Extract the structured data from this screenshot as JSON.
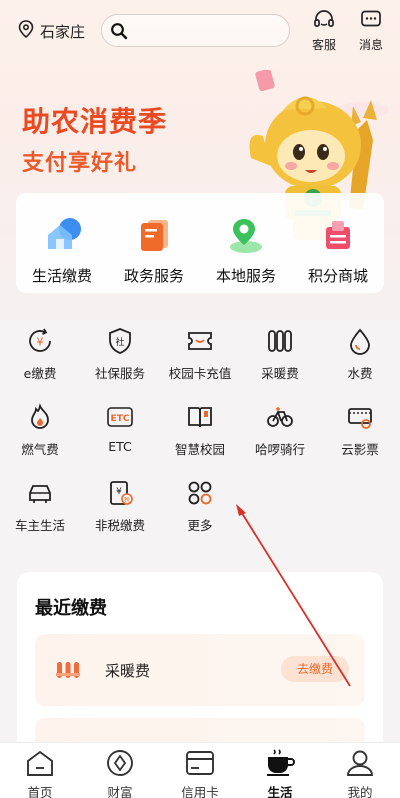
{
  "location": {
    "city": "石家庄"
  },
  "search": {
    "placeholder": ""
  },
  "top_actions": [
    {
      "label": "客服",
      "icon": "headset-icon"
    },
    {
      "label": "消息",
      "icon": "message-icon"
    }
  ],
  "banner": {
    "title": "助农消费季",
    "subtitle": "支付享好礼"
  },
  "quick_services": [
    {
      "label": "生活缴费",
      "icon": "house-icon"
    },
    {
      "label": "政务服务",
      "icon": "document-icon"
    },
    {
      "label": "本地服务",
      "icon": "location-map-icon"
    },
    {
      "label": "积分商城",
      "icon": "gift-box-icon"
    }
  ],
  "services": [
    {
      "label": "e缴费",
      "icon": "yuan-refresh-icon"
    },
    {
      "label": "社保服务",
      "icon": "shield-icon"
    },
    {
      "label": "校园卡充值",
      "icon": "card-smile-icon"
    },
    {
      "label": "采暖费",
      "icon": "radiator-icon"
    },
    {
      "label": "水费",
      "icon": "water-drop-icon"
    },
    {
      "label": "燃气费",
      "icon": "flame-icon"
    },
    {
      "label": "ETC",
      "icon": "etc-icon"
    },
    {
      "label": "智慧校园",
      "icon": "book-icon"
    },
    {
      "label": "哈啰骑行",
      "icon": "bicycle-icon"
    },
    {
      "label": "云影票",
      "icon": "ticket-icon"
    },
    {
      "label": "车主生活",
      "icon": "car-icon"
    },
    {
      "label": "非税缴费",
      "icon": "tax-invoice-icon"
    },
    {
      "label": "更多",
      "icon": "more-grid-icon"
    }
  ],
  "recent": {
    "title": "最近缴费",
    "items": [
      {
        "label": "采暖费",
        "action": "去缴费",
        "icon": "radiator-icon"
      }
    ]
  },
  "bottom_nav": [
    {
      "label": "首页",
      "icon": "home-icon",
      "active": false
    },
    {
      "label": "财富",
      "icon": "compass-icon",
      "active": false
    },
    {
      "label": "信用卡",
      "icon": "credit-card-icon",
      "active": false
    },
    {
      "label": "生活",
      "icon": "coffee-cup-icon",
      "active": true
    },
    {
      "label": "我的",
      "icon": "user-icon",
      "active": false
    }
  ],
  "colors": {
    "accent": "#ea4a22",
    "brand_orange": "#e86a2c",
    "annotation_arrow": "#d9302a"
  }
}
